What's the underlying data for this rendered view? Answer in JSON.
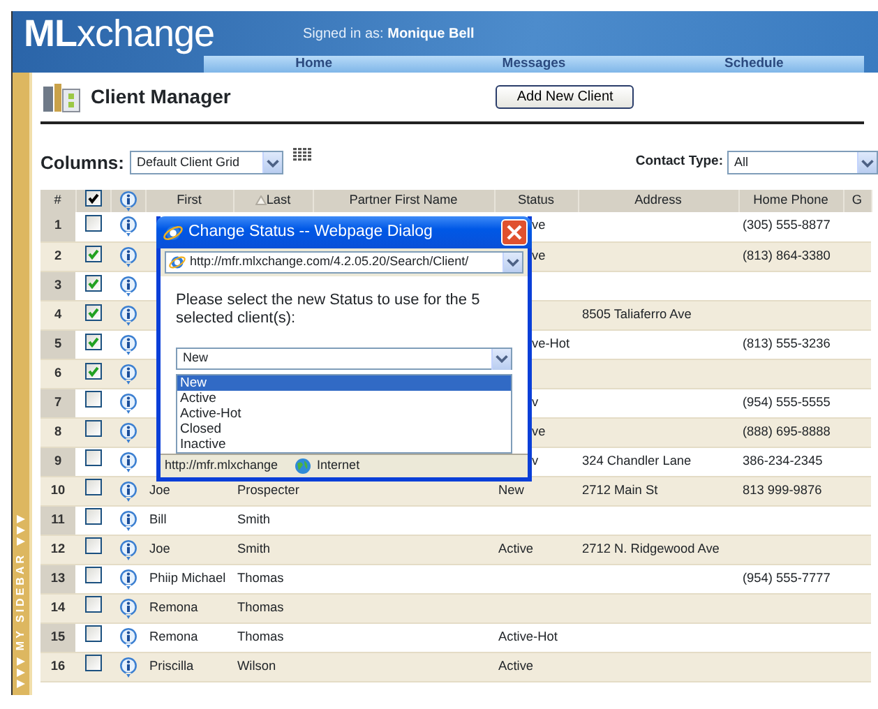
{
  "header": {
    "logo": "**ML**xchange",
    "signed_in_label": "Signed in as:",
    "user": "Monique Bell",
    "nav": [
      "Home",
      "Messages",
      "Schedule"
    ]
  },
  "sidebar": {
    "label": "MY SIDEBAR"
  },
  "page_title": "Client Manager",
  "add_button": "Add New Client",
  "columns_label": "Columns:",
  "columns_select": "Default Client Grid",
  "contact_type_label": "Contact Type:",
  "contact_type_select": "All",
  "table": {
    "columns": [
      "#",
      "First",
      "Last",
      "Partner First Name",
      "Status",
      "Address",
      "Home Phone",
      "G"
    ],
    "select_all_checked": true,
    "rows": [
      {
        "number": "1",
        "checked": false,
        "covered": true,
        "status": "ve",
        "phone": "(305) 555-8877"
      },
      {
        "number": "2",
        "checked": true,
        "covered": true,
        "status": "ve",
        "phone": "(813) 864-3380"
      },
      {
        "number": "3",
        "checked": true
      },
      {
        "number": "4",
        "checked": true,
        "address": "8505 Taliaferro Ave"
      },
      {
        "number": "5",
        "checked": true,
        "covered": true,
        "status": "ve-Hot",
        "phone": "(813) 555-3236"
      },
      {
        "number": "6",
        "checked": true
      },
      {
        "number": "7",
        "checked": false,
        "covered": true,
        "status": "v",
        "phone": "(954) 555-5555"
      },
      {
        "number": "8",
        "checked": false,
        "covered": true,
        "status": "ve",
        "phone": "(888) 695-8888"
      },
      {
        "number": "9",
        "checked": false,
        "covered": true,
        "status": "v",
        "address": "324 Chandler Lane",
        "phone": "386-234-2345"
      },
      {
        "number": "10",
        "checked": false,
        "covered": false,
        "first": "Joe",
        "last": "Prospecter",
        "status": "New",
        "address": "2712 Main St",
        "phone": "813 999-9876"
      },
      {
        "number": "11",
        "checked": false,
        "first": "Bill",
        "last": "Smith"
      },
      {
        "number": "12",
        "checked": false,
        "covered": false,
        "first": "Joe",
        "last": "Smith",
        "status": "Active",
        "address": "2712 N. Ridgewood Ave"
      },
      {
        "number": "13",
        "checked": false,
        "first": "Phiip Michael",
        "last": "Thomas",
        "phone": "(954) 555-7777"
      },
      {
        "number": "14",
        "checked": false,
        "first": "Remona",
        "last": "Thomas"
      },
      {
        "number": "15",
        "checked": false,
        "covered": false,
        "first": "Remona",
        "last": "Thomas",
        "status": "Active-Hot"
      },
      {
        "number": "16",
        "checked": false,
        "covered": false,
        "first": "Priscilla",
        "last": "Wilson",
        "status": "Active"
      }
    ]
  },
  "dialog": {
    "title": "Change Status -- Webpage Dialog",
    "address": "http://mfr.mlxchange.com/4.2.05.20/Search/Client/",
    "message": "Please select the new Status to use for the 5 selected client(s):",
    "select_value": "New",
    "options": [
      {
        "label": "New",
        "selected": true
      },
      {
        "label": "Active",
        "selected": false
      },
      {
        "label": "Active-Hot",
        "selected": false
      },
      {
        "label": "Closed",
        "selected": false
      },
      {
        "label": "Inactive",
        "selected": false
      }
    ],
    "status_url": "http://mfr.mlxchange",
    "status_zone": "Internet"
  }
}
